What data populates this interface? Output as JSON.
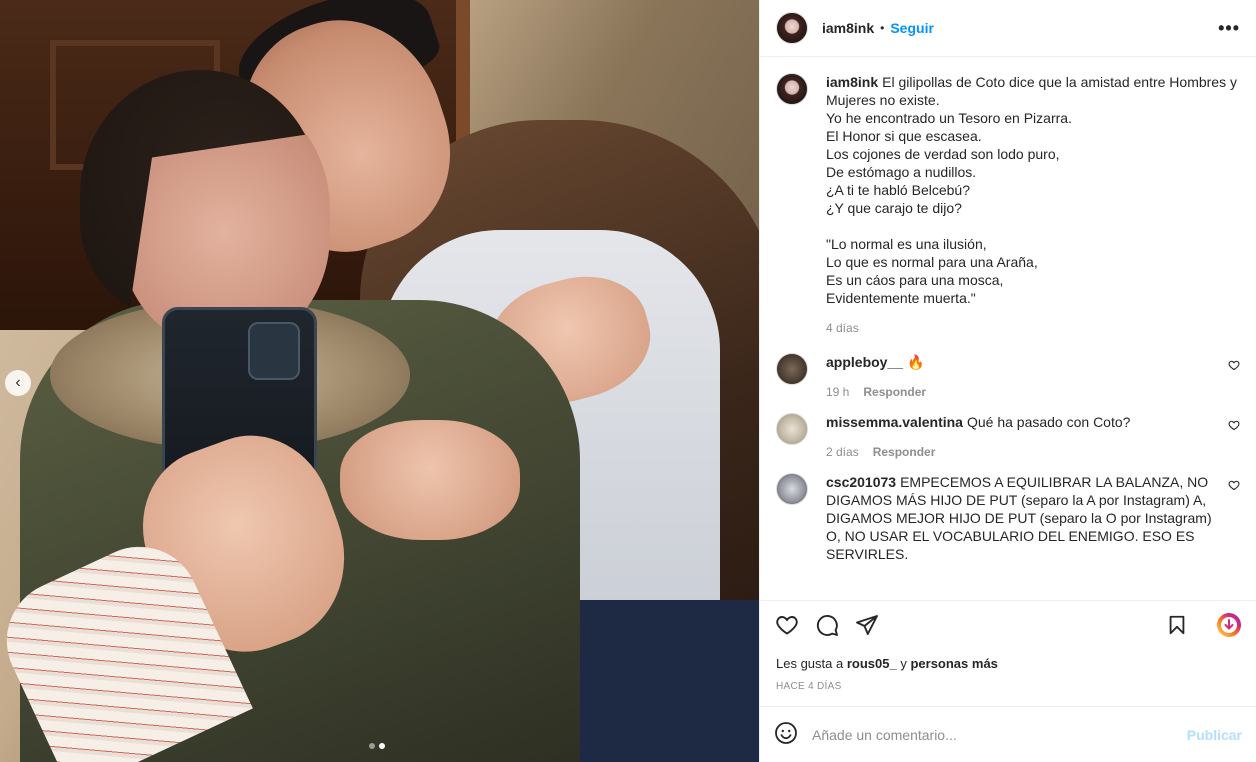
{
  "header": {
    "username": "iam8ink",
    "separator": "•",
    "follow_label": "Seguir",
    "more_label": "•••"
  },
  "caption": {
    "username": "iam8ink",
    "lines": [
      "El gilipollas de Coto dice que la amistad entre Hombres y Mujeres no existe.",
      "Yo he encontrado un Tesoro en Pizarra.",
      "El Honor si que escasea.",
      "Los cojones de verdad son lodo puro,",
      "De estómago a nudillos.",
      "¿A ti te habló Belcebú?",
      "¿Y que carajo te dijo?",
      "",
      "\"Lo normal es una ilusión,",
      "Lo que es normal para una Araña,",
      "Es un cáos para una mosca,",
      "Evidentemente muerta.\""
    ],
    "time": "4 días"
  },
  "comments": [
    {
      "username": "appleboy__",
      "text": "🔥",
      "time": "19 h",
      "reply": "Responder"
    },
    {
      "username": "missemma.valentina",
      "text": "Qué ha pasado con Coto?",
      "time": "2 días",
      "reply": "Responder"
    },
    {
      "username": "csc201073",
      "text": "EMPECEMOS A EQUILIBRAR LA BALANZA, NO DIGAMOS MÁS HIJO DE PUT (separo la A por Instagram) A, DIGAMOS MEJOR HIJO DE PUT (separo la O por Instagram) O, NO USAR EL VOCABULARIO DEL ENEMIGO. ESO ES SERVIRLES.",
      "time": "",
      "reply": ""
    }
  ],
  "likes": {
    "prefix": "Les gusta a",
    "user": "rous05_",
    "middle": "y",
    "suffix": "personas más"
  },
  "post_date": "HACE 4 DÍAS",
  "add_comment": {
    "placeholder": "Añade un comentario...",
    "publish_label": "Publicar"
  },
  "media": {
    "prev_arrow": "‹",
    "carousel_count": 2,
    "carousel_active": 1
  },
  "colors": {
    "link_blue": "#0095f6",
    "publish_disabled": "#b2dffc",
    "muted": "#8e8e8e"
  }
}
